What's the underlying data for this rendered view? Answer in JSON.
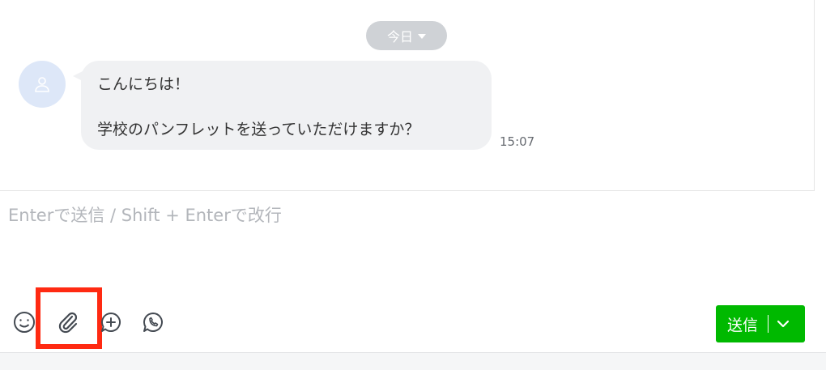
{
  "date_divider": {
    "label": "今日"
  },
  "message": {
    "line1": "こんにちは！",
    "line2": "学校のパンフレットを送っていただけますか？",
    "time": "15:07"
  },
  "composer": {
    "placeholder": "Enterで送信 / Shift + Enterで改行",
    "value": ""
  },
  "toolbar": {
    "icons": [
      "emoji-icon",
      "paperclip-icon",
      "add-comment-icon",
      "call-icon"
    ]
  },
  "send_button": {
    "label": "送信"
  },
  "colors": {
    "send_green": "#00b900",
    "highlight_red": "#ff2a12",
    "bubble_bg": "#f0f1f3",
    "avatar_bg": "#dde7f8"
  }
}
